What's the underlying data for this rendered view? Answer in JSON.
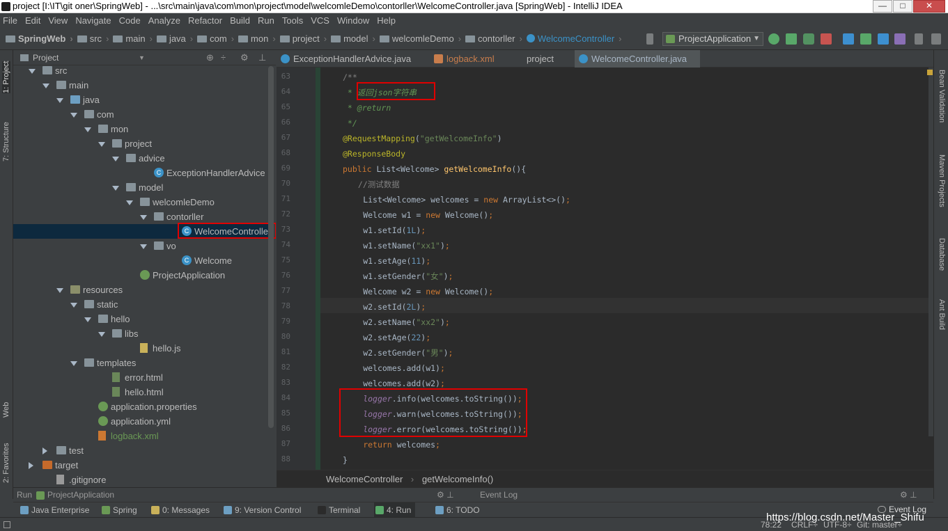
{
  "window": {
    "title": "project [I:\\IT\\git oner\\SpringWeb] - ...\\src\\main\\java\\com\\mon\\project\\model\\welcomleDemo\\contorller\\WelcomeController.java [SpringWeb] - IntelliJ IDEA",
    "btn_min": "—",
    "btn_max": "□",
    "btn_close": "✕"
  },
  "menu": [
    "File",
    "Edit",
    "View",
    "Navigate",
    "Code",
    "Analyze",
    "Refactor",
    "Build",
    "Run",
    "Tools",
    "VCS",
    "Window",
    "Help"
  ],
  "breadcrumbs": [
    "SpringWeb",
    "src",
    "main",
    "java",
    "com",
    "mon",
    "project",
    "model",
    "welcomleDemo",
    "contorller",
    "WelcomeController"
  ],
  "run_config": "ProjectApplication",
  "left_strip": {
    "project": "1: Project",
    "structure": "7: Structure",
    "web": "Web",
    "favorites": "2: Favorites"
  },
  "right_strip": {
    "bean": "Bean Validation",
    "maven": "Maven Projects",
    "database": "Database",
    "ant": "Ant Build"
  },
  "project_panel": {
    "header": "Project",
    "tree": [
      {
        "label": "src",
        "depth": 0,
        "icon": "folder",
        "open": true
      },
      {
        "label": "main",
        "depth": 1,
        "icon": "folder",
        "open": true
      },
      {
        "label": "java",
        "depth": 2,
        "icon": "srcfolder",
        "open": true
      },
      {
        "label": "com",
        "depth": 3,
        "icon": "folder",
        "open": true
      },
      {
        "label": "mon",
        "depth": 4,
        "icon": "folder",
        "open": true
      },
      {
        "label": "project",
        "depth": 5,
        "icon": "folder",
        "open": true
      },
      {
        "label": "advice",
        "depth": 6,
        "icon": "folder",
        "open": true
      },
      {
        "label": "ExceptionHandlerAdvice",
        "depth": 8,
        "icon": "cls",
        "open": null
      },
      {
        "label": "model",
        "depth": 6,
        "icon": "folder",
        "open": true
      },
      {
        "label": "welcomleDemo",
        "depth": 7,
        "icon": "folder",
        "open": true
      },
      {
        "label": "contorller",
        "depth": 8,
        "icon": "folder",
        "open": true
      },
      {
        "label": "WelcomeController",
        "depth": 10,
        "icon": "cls",
        "open": null,
        "selected": true
      },
      {
        "label": "vo",
        "depth": 8,
        "icon": "folder",
        "open": true
      },
      {
        "label": "Welcome",
        "depth": 10,
        "icon": "cls",
        "open": null
      },
      {
        "label": "ProjectApplication",
        "depth": 7,
        "icon": "spring",
        "open": null
      },
      {
        "label": "resources",
        "depth": 2,
        "icon": "resfolder",
        "open": true
      },
      {
        "label": "static",
        "depth": 3,
        "icon": "folder",
        "open": true
      },
      {
        "label": "hello",
        "depth": 4,
        "icon": "folder",
        "open": true
      },
      {
        "label": "libs",
        "depth": 5,
        "icon": "folder",
        "open": true
      },
      {
        "label": "hello.js",
        "depth": 7,
        "icon": "js",
        "open": null
      },
      {
        "label": "templates",
        "depth": 3,
        "icon": "folder",
        "open": true
      },
      {
        "label": "error.html",
        "depth": 5,
        "icon": "html",
        "open": null
      },
      {
        "label": "hello.html",
        "depth": 5,
        "icon": "html",
        "open": null
      },
      {
        "label": "application.properties",
        "depth": 4,
        "icon": "spring",
        "open": null
      },
      {
        "label": "application.yml",
        "depth": 4,
        "icon": "spring",
        "open": null
      },
      {
        "label": "logback.xml",
        "depth": 4,
        "icon": "xml",
        "open": null,
        "green": true
      },
      {
        "label": "test",
        "depth": 1,
        "icon": "folder",
        "open": false
      },
      {
        "label": "target",
        "depth": 0,
        "icon": "excl",
        "open": false,
        "outer": true
      },
      {
        "label": ".gitignore",
        "depth": 1,
        "icon": "git",
        "open": null
      }
    ]
  },
  "tabs": [
    {
      "label": "ExceptionHandlerAdvice.java",
      "icon": "class-icon"
    },
    {
      "label": "logback.xml",
      "icon": "xml-icon",
      "color": "#c87d4c"
    },
    {
      "label": "project",
      "icon": "maven-icon"
    },
    {
      "label": "WelcomeController.java",
      "icon": "class-icon",
      "active": true
    }
  ],
  "code": {
    "line_numbers": [
      "63",
      "64",
      "65",
      "66",
      "67",
      "68",
      "69",
      "70",
      "71",
      "72",
      "73",
      "74",
      "75",
      "76",
      "77",
      "78",
      "79",
      "80",
      "81",
      "82",
      "83",
      "84",
      "85",
      "86",
      "87",
      "88"
    ],
    "lines": [
      {
        "t": [
          [
            "cmt",
            "/**"
          ]
        ],
        "indent": 0
      },
      {
        "t": [
          [
            "doc",
            " * "
          ],
          [
            "doc",
            "返回"
          ],
          [
            "doc",
            "json"
          ],
          [
            "doc",
            "字符串"
          ]
        ],
        "indent": 0
      },
      {
        "t": [
          [
            "doc",
            " * "
          ],
          [
            "doc",
            "@return"
          ]
        ],
        "indent": 0
      },
      {
        "t": [
          [
            "doc",
            " */"
          ]
        ],
        "indent": 0
      },
      {
        "t": [
          [
            "ann",
            "@RequestMapping"
          ],
          [
            "",
            "("
          ],
          [
            "str",
            "\"getWelcomeInfo\""
          ],
          [
            "",
            ")"
          ]
        ],
        "indent": 0
      },
      {
        "t": [
          [
            "ann",
            "@ResponseBody"
          ]
        ],
        "indent": 0
      },
      {
        "t": [
          [
            "kw",
            "public "
          ],
          [
            "",
            "List<Welcome> "
          ],
          [
            "fn",
            "getWelcomeInfo"
          ],
          [
            "",
            "(){"
          ]
        ],
        "indent": 0
      },
      {
        "t": [
          [
            "cmt",
            "//测试数据"
          ]
        ],
        "indent": 3
      },
      {
        "t": [
          [
            "",
            "List<Welcome> welcomes = "
          ],
          [
            "kw",
            "new "
          ],
          [
            "",
            "ArrayList<>()"
          ],
          [
            "kw",
            ";"
          ]
        ],
        "indent": 4
      },
      {
        "t": [
          [
            "",
            "Welcome w1 = "
          ],
          [
            "kw",
            "new "
          ],
          [
            "",
            "Welcome()"
          ],
          [
            "kw",
            ";"
          ]
        ],
        "indent": 4
      },
      {
        "t": [
          [
            "",
            "w1.setId("
          ],
          [
            "num",
            "1L"
          ],
          [
            "",
            ")"
          ],
          [
            "kw",
            ";"
          ]
        ],
        "indent": 4
      },
      {
        "t": [
          [
            "",
            "w1.setName("
          ],
          [
            "str",
            "\"xx1\""
          ],
          [
            "",
            ")"
          ],
          [
            "kw",
            ";"
          ]
        ],
        "indent": 4
      },
      {
        "t": [
          [
            "",
            "w1.setAge("
          ],
          [
            "num",
            "11"
          ],
          [
            "",
            ")"
          ],
          [
            "kw",
            ";"
          ]
        ],
        "indent": 4
      },
      {
        "t": [
          [
            "",
            "w1.setGender("
          ],
          [
            "str",
            "\"女\""
          ],
          [
            "",
            ")"
          ],
          [
            "kw",
            ";"
          ]
        ],
        "indent": 4
      },
      {
        "t": [
          [
            "",
            "Welcome w2 = "
          ],
          [
            "kw",
            "new "
          ],
          [
            "",
            "Welcome()"
          ],
          [
            "kw",
            ";"
          ]
        ],
        "indent": 4
      },
      {
        "t": [
          [
            "",
            "w2.setId("
          ],
          [
            "num",
            "2L"
          ],
          [
            "",
            ")"
          ],
          [
            "kw",
            ";"
          ]
        ],
        "indent": 4
      },
      {
        "t": [
          [
            "",
            "w2.setName("
          ],
          [
            "str",
            "\"xx2\""
          ],
          [
            "",
            ")"
          ],
          [
            "kw",
            ";"
          ]
        ],
        "indent": 4
      },
      {
        "t": [
          [
            "",
            "w2.setAge("
          ],
          [
            "num",
            "22"
          ],
          [
            "",
            ")"
          ],
          [
            "kw",
            ";"
          ]
        ],
        "indent": 4
      },
      {
        "t": [
          [
            "",
            "w2.setGender("
          ],
          [
            "str",
            "\"男\""
          ],
          [
            "",
            ")"
          ],
          [
            "kw",
            ";"
          ]
        ],
        "indent": 4
      },
      {
        "t": [
          [
            "",
            "welcomes.add(w1)"
          ],
          [
            "kw",
            ";"
          ]
        ],
        "indent": 4
      },
      {
        "t": [
          [
            "",
            "welcomes.add(w2)"
          ],
          [
            "kw",
            ";"
          ]
        ],
        "indent": 4
      },
      {
        "t": [
          [
            "fld",
            "logger"
          ],
          [
            "",
            ".info(welcomes.toString())"
          ],
          [
            "kw",
            ";"
          ]
        ],
        "indent": 4
      },
      {
        "t": [
          [
            "fld",
            "logger"
          ],
          [
            "",
            ".warn(welcomes.toString())"
          ],
          [
            "kw",
            ";"
          ]
        ],
        "indent": 4
      },
      {
        "t": [
          [
            "fld",
            "logger"
          ],
          [
            "",
            ".error(welcomes.toString())"
          ],
          [
            "kw",
            ";"
          ]
        ],
        "indent": 4
      },
      {
        "t": [
          [
            "kw",
            "return "
          ],
          [
            "",
            "welcomes"
          ],
          [
            "kw",
            ";"
          ]
        ],
        "indent": 4
      },
      {
        "t": [
          [
            "",
            "}"
          ]
        ],
        "indent": 0
      }
    ]
  },
  "editor_breadcrumb": {
    "cls": "WelcomeController",
    "method": "getWelcomeInfo()"
  },
  "run_bar": {
    "label": "Run",
    "config": "ProjectApplication",
    "event_log": "Event Log"
  },
  "bottom_tools": [
    {
      "label": "Java Enterprise",
      "color": "#6d9fc2"
    },
    {
      "label": "Spring",
      "color": "#6a9955"
    },
    {
      "label": "0: Messages",
      "color": "#c9b15a"
    },
    {
      "label": "9: Version Control",
      "color": "#6d9fc2"
    },
    {
      "label": "Terminal",
      "color": "#2b2b2b"
    },
    {
      "label": "4: Run",
      "color": "#59a869",
      "active": true
    },
    {
      "label": "6: TODO",
      "color": "#6d9fc2"
    }
  ],
  "bottom_event_log": "Event Log",
  "status": {
    "position": "78:22",
    "line_sep": "CRLF÷",
    "encoding": "UTF-8÷",
    "git": "Git: master÷"
  },
  "watermark": "https://blog.csdn.net/Master_Shifu"
}
